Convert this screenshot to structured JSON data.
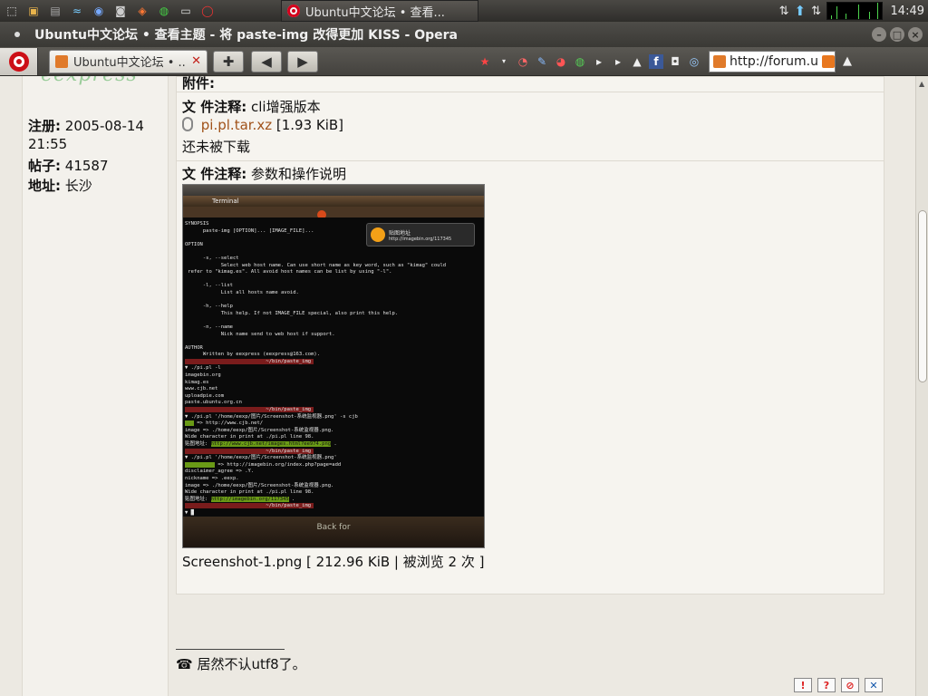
{
  "panel": {
    "task_title": "Ubuntu中文论坛 • 查看...",
    "clock": "14:49"
  },
  "window": {
    "title": "Ubuntu中文论坛 • 查看主题 - 将 paste-img 改得更加 KISS - Opera"
  },
  "toolbar": {
    "tab_title": "Ubuntu中文论坛 • ...",
    "address": "http://forum.u"
  },
  "profile": {
    "register_label": "注册:",
    "register_date": "2005-08-14",
    "register_time": "21:55",
    "posts_label": "帖子:",
    "posts_count": "41587",
    "location_label": "地址:",
    "location": "长沙"
  },
  "post": {
    "attachments_header": "附件:",
    "attachment1": {
      "comment_label": "文 件注释:",
      "comment": "cli增强版本",
      "filename": "pi.pl.tar.xz",
      "size": "[1.93 KiB]",
      "downloads": "还未被下载"
    },
    "attachment2": {
      "comment_label": "文 件注释:",
      "comment": "参数和操作说明",
      "caption": "Screenshot-1.png [ 212.96 KiB | 被浏览 2 次 ]"
    },
    "signature": "居然不认utf8了。"
  },
  "screenshot": {
    "window_title": "Terminal",
    "notify_title": "贴图地址",
    "notify_url": "http://imagebin.org/117345",
    "bottom_text": "Back for "
  }
}
